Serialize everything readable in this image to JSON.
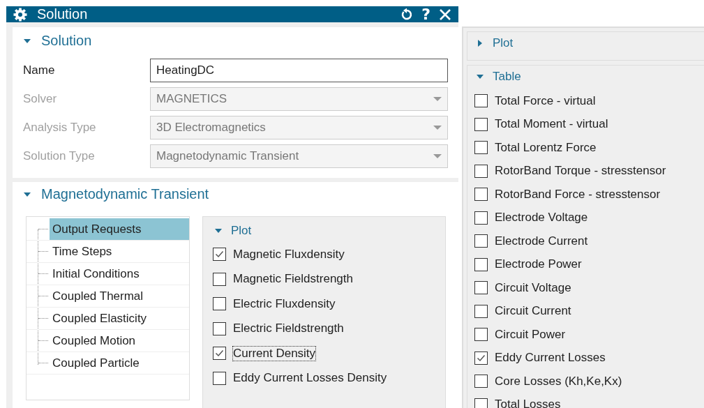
{
  "dialog": {
    "title": "Solution",
    "buttons": [
      {
        "kind": "reset"
      },
      {
        "kind": "help",
        "label": "?"
      },
      {
        "kind": "close"
      }
    ]
  },
  "solution_section": {
    "title": "Solution",
    "expanded": true,
    "fields": [
      {
        "label": "Name",
        "kind": "text",
        "value": "HeatingDC",
        "disabled": false
      },
      {
        "label": "Solver",
        "kind": "dropdown",
        "value": "MAGNETICS",
        "disabled": true
      },
      {
        "label": "Analysis Type",
        "kind": "dropdown",
        "value": "3D Electromagnetics",
        "disabled": true
      },
      {
        "label": "Solution Type",
        "kind": "dropdown",
        "value": "Magnetodynamic Transient",
        "disabled": true
      }
    ]
  },
  "transient_section": {
    "title": "Magnetodynamic Transient",
    "expanded": true,
    "tree": [
      {
        "label": "Output Requests",
        "selected": true
      },
      {
        "label": "Time Steps",
        "selected": false
      },
      {
        "label": "Initial Conditions",
        "selected": false
      },
      {
        "label": "Coupled Thermal",
        "selected": false
      },
      {
        "label": "Coupled Elasticity",
        "selected": false
      },
      {
        "label": "Coupled Motion",
        "selected": false
      },
      {
        "label": "Coupled Particle",
        "selected": false
      }
    ],
    "plot": {
      "title": "Plot",
      "expanded": true,
      "items": [
        {
          "label": "Magnetic Fluxdensity",
          "checked": true,
          "focused": false
        },
        {
          "label": "Magnetic Fieldstrength",
          "checked": false,
          "focused": false
        },
        {
          "label": "Electric Fluxdensity",
          "checked": false,
          "focused": false
        },
        {
          "label": "Electric Fieldstrength",
          "checked": false,
          "focused": false
        },
        {
          "label": "Current Density",
          "checked": true,
          "focused": true
        },
        {
          "label": "Eddy Current Losses Density",
          "checked": false,
          "focused": false
        }
      ]
    }
  },
  "side_panel": {
    "sections": [
      {
        "title": "Plot",
        "expanded": false
      },
      {
        "title": "Table",
        "expanded": true,
        "items": [
          {
            "label": "Total Force - virtual",
            "checked": false
          },
          {
            "label": "Total Moment - virtual",
            "checked": false
          },
          {
            "label": "Total Lorentz Force",
            "checked": false
          },
          {
            "label": "RotorBand Torque - stresstensor",
            "checked": false
          },
          {
            "label": "RotorBand Force - stresstensor",
            "checked": false
          },
          {
            "label": "Electrode Voltage",
            "checked": false
          },
          {
            "label": "Electrode Current",
            "checked": false
          },
          {
            "label": "Electrode Power",
            "checked": false
          },
          {
            "label": "Circuit Voltage",
            "checked": false
          },
          {
            "label": "Circuit Current",
            "checked": false
          },
          {
            "label": "Circuit Power",
            "checked": false
          },
          {
            "label": "Eddy Current Losses",
            "checked": true
          },
          {
            "label": "Core Losses (Kh,Ke,Kx)",
            "checked": false
          },
          {
            "label": "Total Losses",
            "checked": false
          }
        ]
      }
    ]
  }
}
